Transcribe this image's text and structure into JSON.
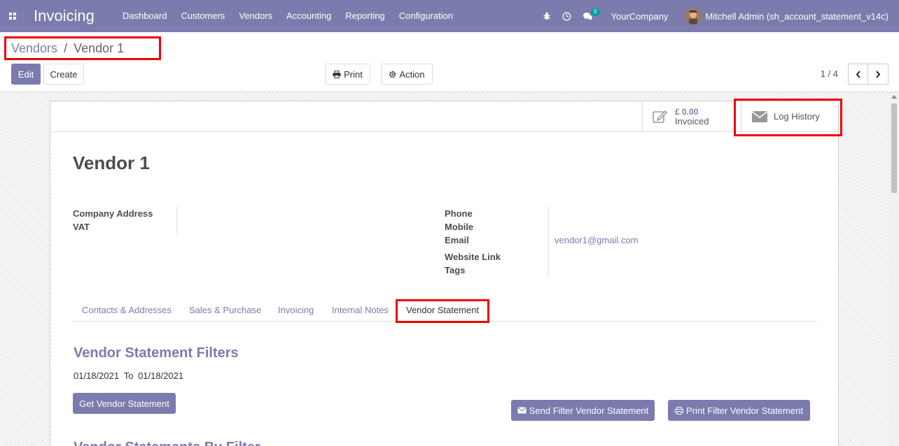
{
  "navbar": {
    "app_title": "Invoicing",
    "menu": [
      "Dashboard",
      "Customers",
      "Vendors",
      "Accounting",
      "Reporting",
      "Configuration"
    ],
    "chat_badge": "5",
    "company": "YourCompany",
    "user": "Mitchell Admin (sh_account_statement_v14c)"
  },
  "breadcrumb": {
    "parent": "Vendors",
    "separator": "/",
    "current": "Vendor 1"
  },
  "toolbar": {
    "edit_label": "Edit",
    "create_label": "Create",
    "print_label": "Print",
    "action_label": "Action",
    "pager": "1 / 4"
  },
  "stat_buttons": {
    "invoiced_value": "£ 0.00",
    "invoiced_label": "Invoiced",
    "log_history_label": "Log History"
  },
  "record": {
    "name": "Vendor 1",
    "left_labels": [
      "Company Address",
      "VAT"
    ],
    "right_labels": [
      "Phone",
      "Mobile",
      "Email",
      "Website Link",
      "Tags"
    ],
    "email": "vendor1@gmail.com"
  },
  "tabs": [
    "Contacts & Addresses",
    "Sales & Purchase",
    "Invoicing",
    "Internal Notes",
    "Vendor Statement"
  ],
  "statement": {
    "filters_title": "Vendor Statement Filters",
    "date_from": "01/18/2021",
    "date_to_label": "To",
    "date_to": "01/18/2021",
    "get_button": "Get Vendor Statement",
    "send_button": "Send Filter Vendor Statement",
    "print_button": "Print Filter Vendor Statement",
    "by_filter_title": "Vendor Statements By Filter"
  },
  "colors": {
    "brand": "#7c7bad",
    "highlight": "#ee0000"
  }
}
